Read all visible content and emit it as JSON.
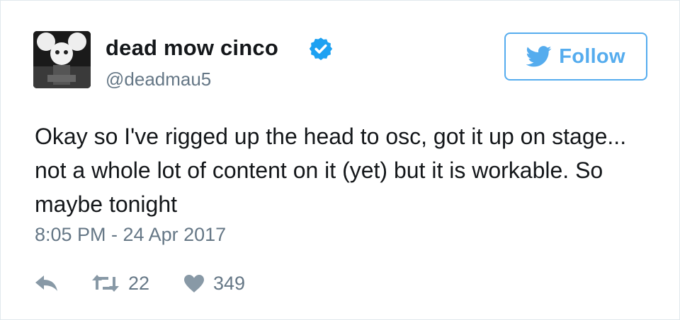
{
  "user": {
    "display_name": "dead mow cinco",
    "handle": "@deadmau5",
    "verified_icon": "verified-badge-icon"
  },
  "follow_button": {
    "label": "Follow",
    "icon": "twitter-bird-icon"
  },
  "tweet": {
    "text": "Okay so I've rigged up the head to osc, got it up on stage... not a whole lot of content on it (yet) but it is workable. So maybe tonight",
    "timestamp": "8:05 PM - 24 Apr 2017"
  },
  "actions": {
    "reply_icon": "reply-icon",
    "retweet_icon": "retweet-icon",
    "retweet_count": "22",
    "like_icon": "heart-icon",
    "like_count": "349"
  },
  "colors": {
    "brand_blue": "#55acee",
    "verified_blue": "#1da1f2",
    "text": "#14171a",
    "muted": "#657786"
  }
}
